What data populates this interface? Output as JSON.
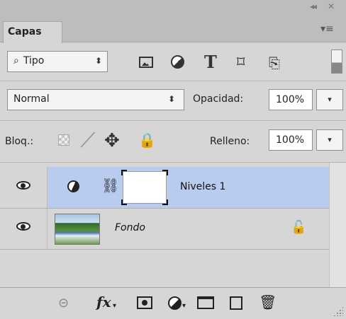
{
  "window": {
    "collapse_glyph": "◂◂",
    "close_glyph": "✕"
  },
  "tabs": {
    "active_label": "Capas",
    "menu_glyph": "▾≡"
  },
  "filter": {
    "kind_label": "Tipo",
    "search_glyph": "⌕",
    "spin_glyph": "⬍",
    "icons": [
      "image-filter-icon",
      "adjustment-filter-icon",
      "type-filter-icon",
      "shape-filter-icon",
      "smart-object-filter-icon"
    ],
    "type_glyph": "T",
    "shape_glyph": "⌑",
    "smart_glyph": "⎘"
  },
  "blend": {
    "mode": "Normal",
    "opacity_label": "Opacidad:",
    "opacity_value": "100%",
    "arrow_glyph": "▾"
  },
  "lock": {
    "label": "Bloq.:",
    "icons": [
      "lock-transparent-icon",
      "lock-pixels-icon",
      "lock-position-icon",
      "lock-all-icon"
    ],
    "pixels_glyph": "╱",
    "position_glyph": "✥",
    "all_glyph": "🔒",
    "fill_label": "Relleno:",
    "fill_value": "100%"
  },
  "layers": [
    {
      "name": "Niveles 1",
      "type": "adjustment",
      "visible": true,
      "selected": true,
      "link_glyph": "⛓"
    },
    {
      "name": "Fondo",
      "type": "background",
      "visible": true,
      "selected": false,
      "locked": true,
      "lock_glyph": "🔓"
    }
  ],
  "bottom_bar": {
    "icons": [
      "link-layers-icon",
      "fx-icon",
      "add-mask-icon",
      "new-adjustment-icon",
      "new-group-icon",
      "new-layer-icon",
      "delete-icon"
    ],
    "link_glyph": "⊝",
    "fx_label": "fx",
    "caret": "▾",
    "delete_glyph": "🗑"
  },
  "colors": {
    "panel_bg": "#d6d6d6",
    "selected_row": "#b9ccf0",
    "header_bg": "#bdbdbd"
  }
}
